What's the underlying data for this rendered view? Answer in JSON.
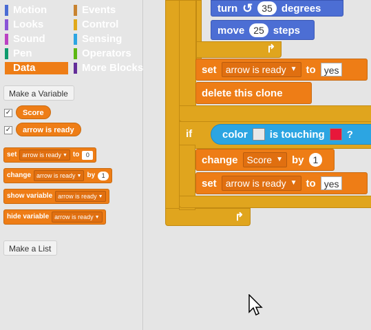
{
  "categories": [
    {
      "label": "Motion",
      "color": "#4a6cd4"
    },
    {
      "label": "Events",
      "color": "#c88330"
    },
    {
      "label": "Looks",
      "color": "#8a55d7"
    },
    {
      "label": "Control",
      "color": "#e1a91a"
    },
    {
      "label": "Sound",
      "color": "#bb42c3"
    },
    {
      "label": "Sensing",
      "color": "#2ca5e2"
    },
    {
      "label": "Pen",
      "color": "#0e9a6c"
    },
    {
      "label": "Operators",
      "color": "#5cb712"
    },
    {
      "label": "Data",
      "color": "#ee7d16"
    },
    {
      "label": "More Blocks",
      "color": "#632d99"
    }
  ],
  "palette": {
    "make_variable": "Make a Variable",
    "make_list": "Make a List",
    "variables": [
      "Score",
      "arrow is ready"
    ],
    "check_mark": "✓",
    "blocks": {
      "set": {
        "word": "set",
        "var": "arrow is ready",
        "to": "to",
        "value": "0"
      },
      "change": {
        "word": "change",
        "var": "arrow is ready",
        "by": "by",
        "value": "1"
      },
      "show": {
        "word": "show variable",
        "var": "arrow is ready"
      },
      "hide": {
        "word": "hide variable",
        "var": "arrow is ready"
      }
    }
  },
  "script": {
    "turn": {
      "word": "turn",
      "icon": "↺",
      "value": "35",
      "unit": "degrees"
    },
    "move": {
      "word": "move",
      "value": "25",
      "unit": "steps"
    },
    "set1": {
      "word": "set",
      "var": "arrow is ready",
      "to": "to",
      "value": "yes"
    },
    "delete": "delete this clone",
    "if": {
      "word": "if",
      "color_word": "color",
      "is_touching": "is touching",
      "q": "?",
      "color_a": "#e8e8e8",
      "color_b": "#e8173a"
    },
    "change": {
      "word": "change",
      "var": "Score",
      "by": "by",
      "value": "1"
    },
    "set2": {
      "word": "set",
      "var": "arrow is ready",
      "to": "to",
      "value": "yes"
    },
    "loop_icon": "↱"
  },
  "dropdown_arrow": "▼"
}
